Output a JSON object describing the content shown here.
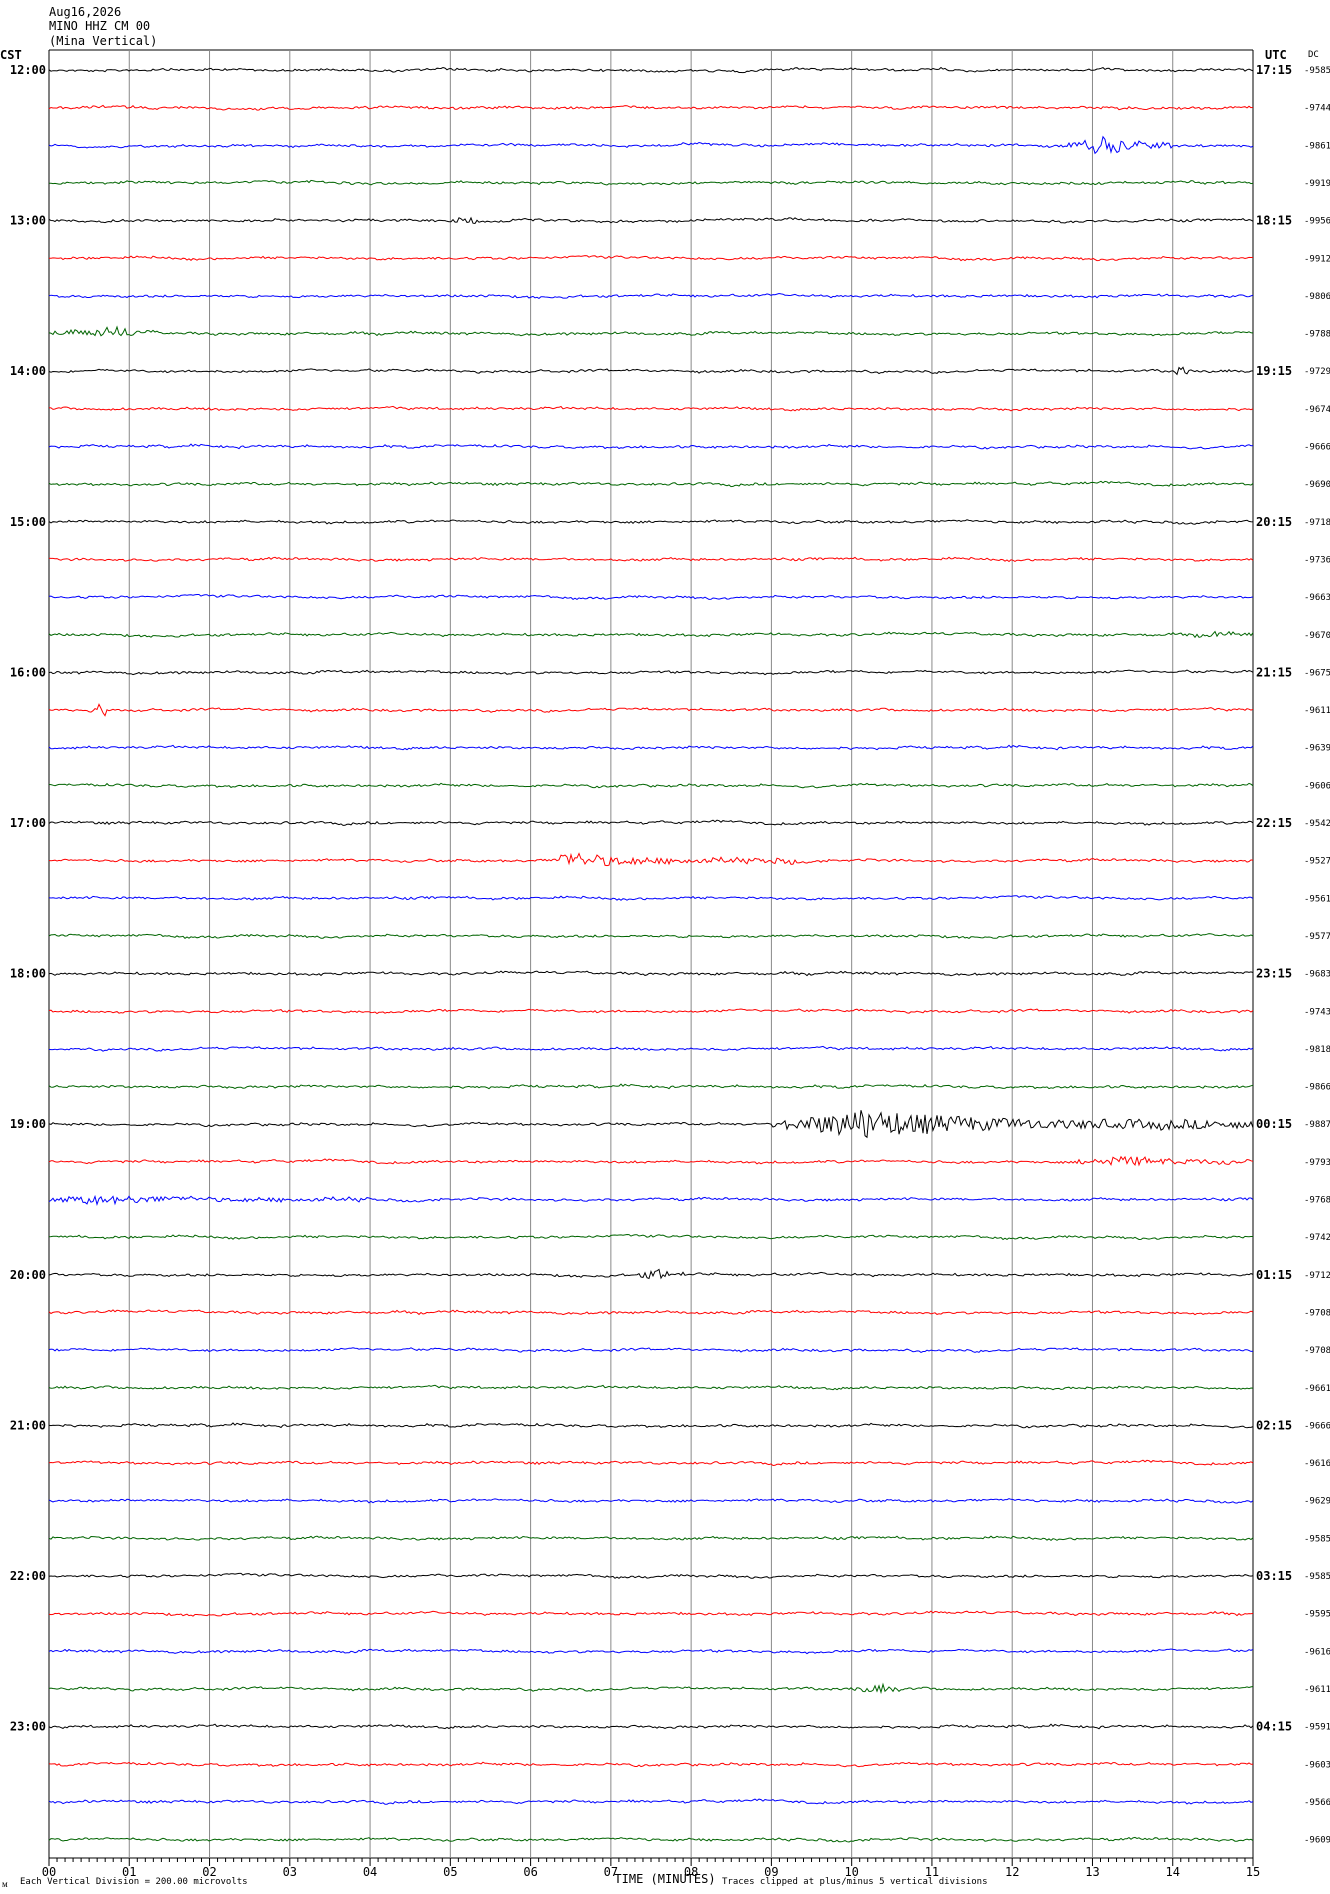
{
  "header": {
    "date": "Aug16,2026",
    "station": "MINO HHZ CM 00",
    "description": "(Mina Vertical)"
  },
  "left_axis_label": "CST",
  "right_axis_label": "UTC",
  "dc_label": "DC",
  "footer": {
    "scale_note": "Each Vertical Division =  200.00 microvolts",
    "clip_note": "Traces clipped at plus/minus 5 vertical divisions",
    "corner_mark": "ᴍ"
  },
  "colors": {
    "trace_cycle": [
      "#000000",
      "#ff0000",
      "#0000ff",
      "#006400"
    ],
    "grid": "#888888"
  },
  "chart_data": {
    "type": "line",
    "xlabel": "TIME (MINUTES)",
    "xlim": [
      0,
      15
    ],
    "x_ticks": [
      "00",
      "01",
      "02",
      "03",
      "04",
      "05",
      "06",
      "07",
      "08",
      "09",
      "10",
      "11",
      "12",
      "13",
      "14",
      "15"
    ],
    "left_hour_labels": [
      "12:00",
      "13:00",
      "14:00",
      "15:00",
      "16:00",
      "17:00",
      "18:00",
      "19:00",
      "20:00",
      "21:00",
      "22:00",
      "23:00"
    ],
    "right_hour_labels": [
      "17:15",
      "18:15",
      "19:15",
      "20:15",
      "21:15",
      "22:15",
      "23:15",
      "00:15",
      "01:15",
      "02:15",
      "03:15",
      "04:15"
    ],
    "dc_offsets": [
      "-9585",
      "-9744",
      "-9861",
      "-9919",
      "-9956",
      "-9912",
      "-9806",
      "-9788",
      "-9729",
      "-9674",
      "-9666",
      "-9690",
      "-9718",
      "-9736",
      "-9663",
      "-9670",
      "-9675",
      "-9611",
      "-9639",
      "-9606",
      "-9542",
      "-9527",
      "-9561",
      "-9577",
      "-9683",
      "-9743",
      "-9818",
      "-9866",
      "-9887",
      "-9793",
      "-9768",
      "-9742",
      "-9712",
      "-9708",
      "-9708",
      "-9661",
      "-9666",
      "-9616",
      "-9629",
      "-9585",
      "-9585",
      "-9595",
      "-9616",
      "-9611",
      "-9591",
      "-9603",
      "-9566",
      "-9609"
    ],
    "events": [
      {
        "line": 2,
        "start": 12.7,
        "peak": 13.2,
        "end": 14.0,
        "amplitude": 12
      },
      {
        "line": 4,
        "start": 5.0,
        "peak": 5.2,
        "end": 5.4,
        "amplitude": 4
      },
      {
        "line": 7,
        "start": 0.0,
        "peak": 0.9,
        "end": 1.3,
        "amplitude": 6
      },
      {
        "line": 8,
        "start": 14.0,
        "peak": 14.1,
        "end": 14.25,
        "amplitude": 5
      },
      {
        "line": 15,
        "start": 14.2,
        "peak": 14.5,
        "end": 15.0,
        "amplitude": 3
      },
      {
        "line": 17,
        "start": 0.55,
        "peak": 0.6,
        "end": 0.7,
        "amplitude": 9
      },
      {
        "line": 21,
        "start": 6.3,
        "peak": 6.4,
        "end": 9.3,
        "amplitude": 9
      },
      {
        "line": 28,
        "start": 9.0,
        "peak": 10.1,
        "end": 15.0,
        "amplitude": 18
      },
      {
        "line": 29,
        "start": 12.8,
        "peak": 13.3,
        "end": 15.0,
        "amplitude": 7
      },
      {
        "line": 30,
        "start": 0.0,
        "peak": 0.5,
        "end": 4.0,
        "amplitude": 5
      },
      {
        "line": 32,
        "start": 7.3,
        "peak": 7.6,
        "end": 7.9,
        "amplitude": 6
      },
      {
        "line": 43,
        "start": 9.9,
        "peak": 10.4,
        "end": 10.6,
        "amplitude": 4
      }
    ]
  }
}
